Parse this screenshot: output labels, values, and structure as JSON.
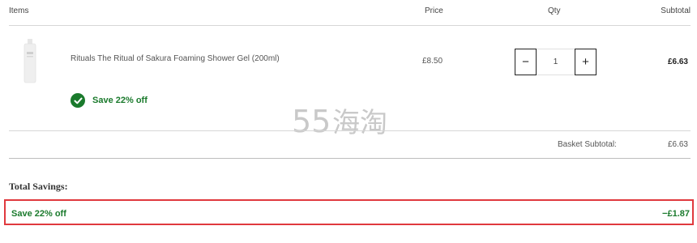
{
  "table_header": {
    "items": "Items",
    "price": "Price",
    "qty": "Qty",
    "subtotal": "Subtotal"
  },
  "product": {
    "name": "Rituals The Ritual of Sakura Foaming Shower Gel (200ml)",
    "image_icon": "shower-gel-bottle-icon",
    "price": "£8.50",
    "quantity": "1",
    "minus_label": "−",
    "plus_label": "+",
    "line_subtotal": "£6.63",
    "promo_text": "Save 22% off",
    "promo_icon": "check-circle-icon"
  },
  "watermark": "55海淘",
  "basket": {
    "label": "Basket Subtotal:",
    "value": "£6.63"
  },
  "savings": {
    "title": "Total Savings:",
    "label": "Save 22% off",
    "value": "−£1.87"
  },
  "colors": {
    "promo_green": "#1a7a2c",
    "highlight_red": "#e0393e",
    "watermark_gray": "#c9c9c9"
  }
}
